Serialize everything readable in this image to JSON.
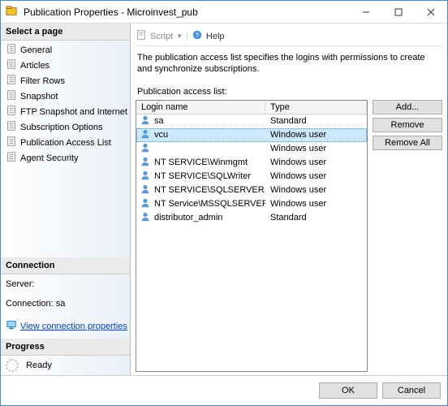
{
  "window": {
    "title": "Publication Properties - Microinvest_pub"
  },
  "toolbar": {
    "script": "Script",
    "help": "Help"
  },
  "sidebar": {
    "select_page": "Select a page",
    "pages": [
      {
        "label": "General"
      },
      {
        "label": "Articles"
      },
      {
        "label": "Filter Rows"
      },
      {
        "label": "Snapshot"
      },
      {
        "label": "FTP Snapshot and Internet"
      },
      {
        "label": "Subscription Options"
      },
      {
        "label": "Publication Access List"
      },
      {
        "label": "Agent Security"
      }
    ],
    "connection_head": "Connection",
    "server_label": "Server:",
    "connection_label": "Connection: sa",
    "view_conn": "View connection properties",
    "progress_head": "Progress",
    "progress_status": "Ready"
  },
  "main": {
    "description": "The publication access list specifies the logins with permissions to create and synchronize subscriptions.",
    "list_label": "Publication access list:",
    "columns": {
      "login": "Login name",
      "type": "Type"
    },
    "rows": [
      {
        "login": "sa",
        "type": "Standard"
      },
      {
        "login": "vcu",
        "type": "Windows user",
        "selected": true
      },
      {
        "login": "",
        "type": "Windows user"
      },
      {
        "login": "NT SERVICE\\Winmgmt",
        "type": "Windows user"
      },
      {
        "login": "NT SERVICE\\SQLWriter",
        "type": "Windows user"
      },
      {
        "login": "NT SERVICE\\SQLSERVER...",
        "type": "Windows user"
      },
      {
        "login": "NT Service\\MSSQLSERVER",
        "type": "Windows user"
      },
      {
        "login": "distributor_admin",
        "type": "Standard"
      }
    ],
    "buttons": {
      "add": "Add...",
      "remove": "Remove",
      "remove_all": "Remove All"
    }
  },
  "footer": {
    "ok": "OK",
    "cancel": "Cancel"
  }
}
